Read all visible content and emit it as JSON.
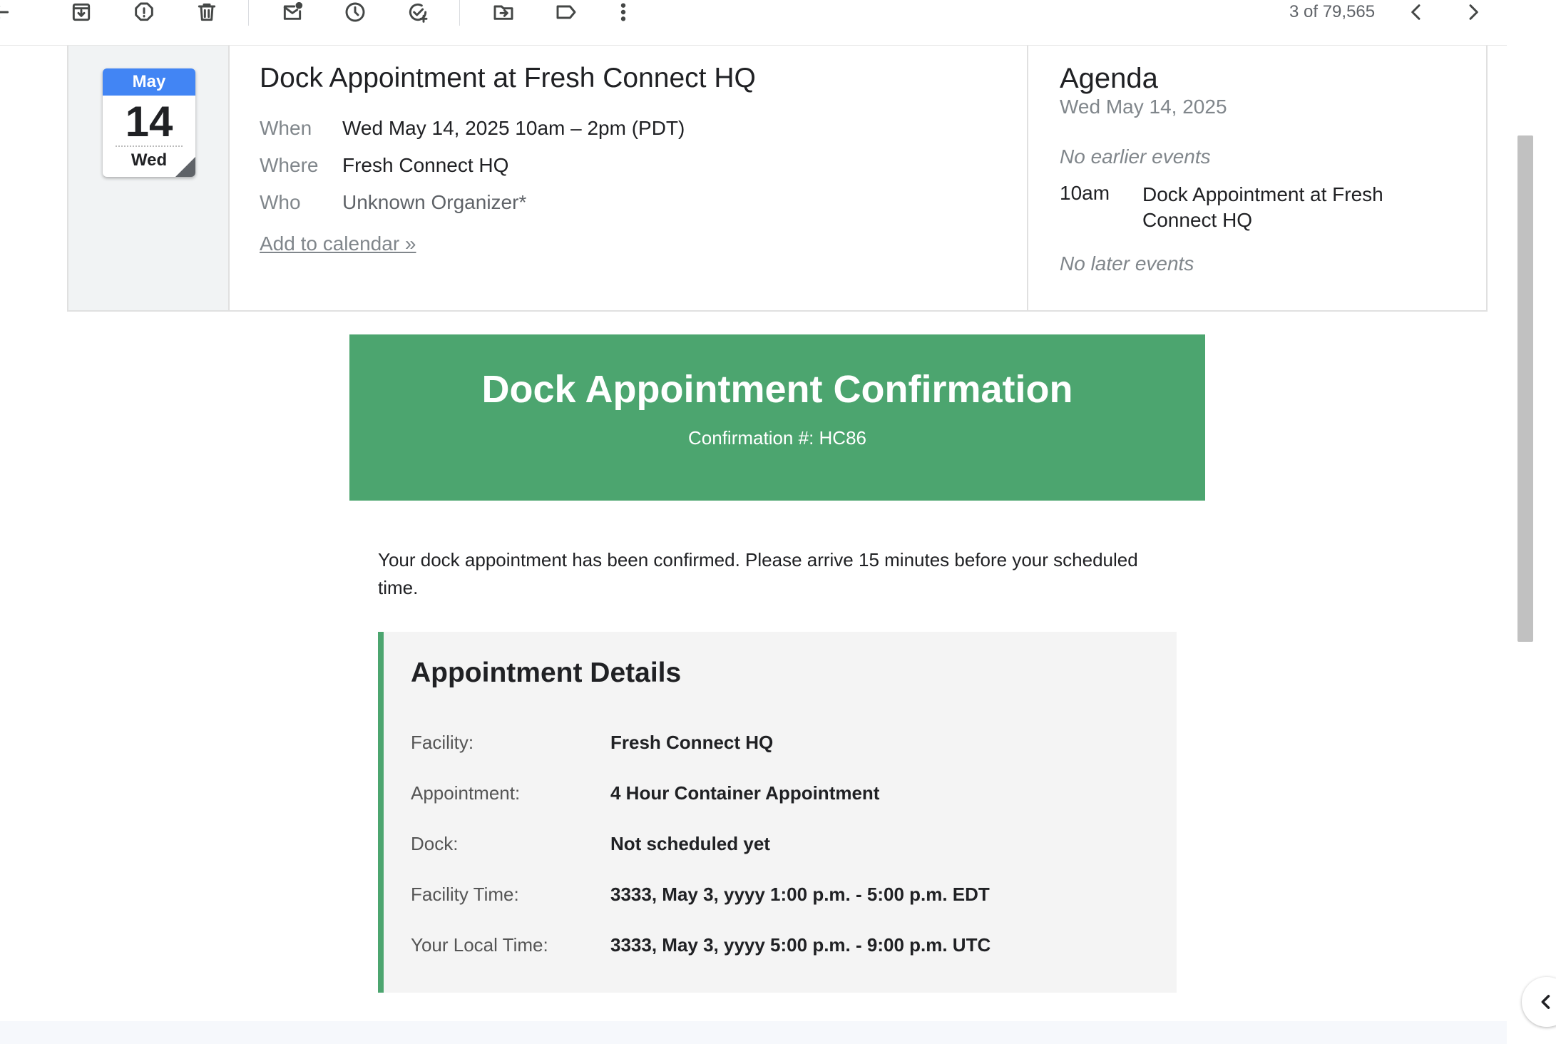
{
  "toolbar": {
    "pager_text": "3 of 79,565"
  },
  "event": {
    "calendar": {
      "month": "May",
      "day": "14",
      "weekday": "Wed"
    },
    "title": "Dock Appointment at Fresh Connect HQ",
    "when_label": "When",
    "when_value": "Wed May 14, 2025 10am – 2pm (PDT)",
    "where_label": "Where",
    "where_value": "Fresh Connect HQ",
    "who_label": "Who",
    "who_value": "Unknown Organizer*",
    "add_link": "Add to calendar »"
  },
  "agenda": {
    "title": "Agenda",
    "date": "Wed May 14, 2025",
    "no_earlier": "No earlier events",
    "event_time": "10am",
    "event_title": "Dock Appointment at Fresh Connect HQ",
    "no_later": "No later events"
  },
  "email": {
    "banner_title": "Dock Appointment Confirmation",
    "banner_subtitle": "Confirmation #: HC86",
    "banner_color": "#4ca56f",
    "intro": "Your dock appointment has been confirmed. Please arrive 15 minutes before your scheduled time.",
    "details_title": "Appointment Details",
    "details": [
      {
        "label": "Facility:",
        "value": "Fresh Connect HQ"
      },
      {
        "label": "Appointment:",
        "value": "4 Hour Container Appointment"
      },
      {
        "label": "Dock:",
        "value": "Not scheduled yet"
      },
      {
        "label": "Facility Time:",
        "value": "3333, May 3, yyyy 1:00 p.m. - 5:00 p.m. EDT"
      },
      {
        "label": "Your Local Time:",
        "value": "3333, May 3, yyyy 5:00 p.m. - 9:00 p.m. UTC"
      }
    ]
  }
}
